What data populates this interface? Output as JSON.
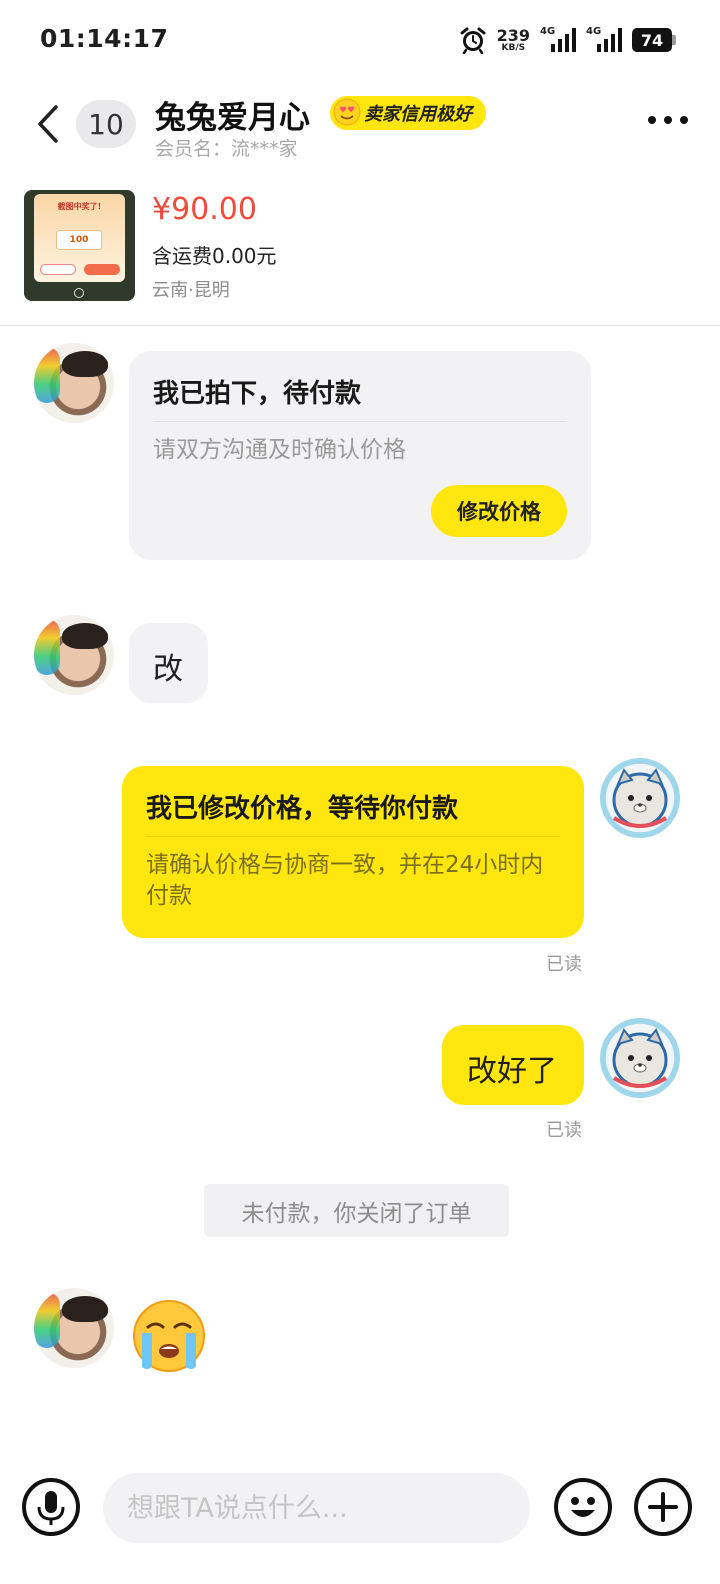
{
  "status_bar": {
    "time": "01:14:17",
    "net_speed": "239",
    "net_speed_unit": "KB/S",
    "signal1_label": "4G",
    "signal2_label": "4G",
    "battery": "74"
  },
  "header": {
    "back_icon": "chevron-left-icon",
    "unread_count": "10",
    "title": "兔兔爱月心",
    "seller_badge": "卖家信用极好",
    "member_name": "会员名：流***家",
    "more_icon": "more-horizontal-icon"
  },
  "product": {
    "thumb_title": "截图中奖了!",
    "thumb_amount": "100",
    "price": "¥90.00",
    "shipping": "含运费0.00元",
    "location": "云南·昆明"
  },
  "messages": {
    "order_card": {
      "title": "我已拍下，待付款",
      "desc": "请双方沟通及时确认价格",
      "button": "修改价格"
    },
    "buyer_text": "改",
    "price_card": {
      "title": "我已修改价格，等待你付款",
      "desc": "请确认价格与协商一致，并在24小时内付款",
      "read": "已读"
    },
    "seller_text": "改好了",
    "seller_text_read": "已读",
    "system_notice": "未付款，你关闭了订单",
    "sticker": "loudly-crying-face-emoji"
  },
  "input_bar": {
    "placeholder": "想跟TA说点什么...",
    "voice_icon": "microphone-icon",
    "emoji_icon": "smiley-icon",
    "plus_icon": "plus-icon"
  },
  "colors": {
    "accent_yellow": "#ffe60f",
    "price_red": "#f04a3a",
    "bubble_gray": "#f2f2f4"
  }
}
